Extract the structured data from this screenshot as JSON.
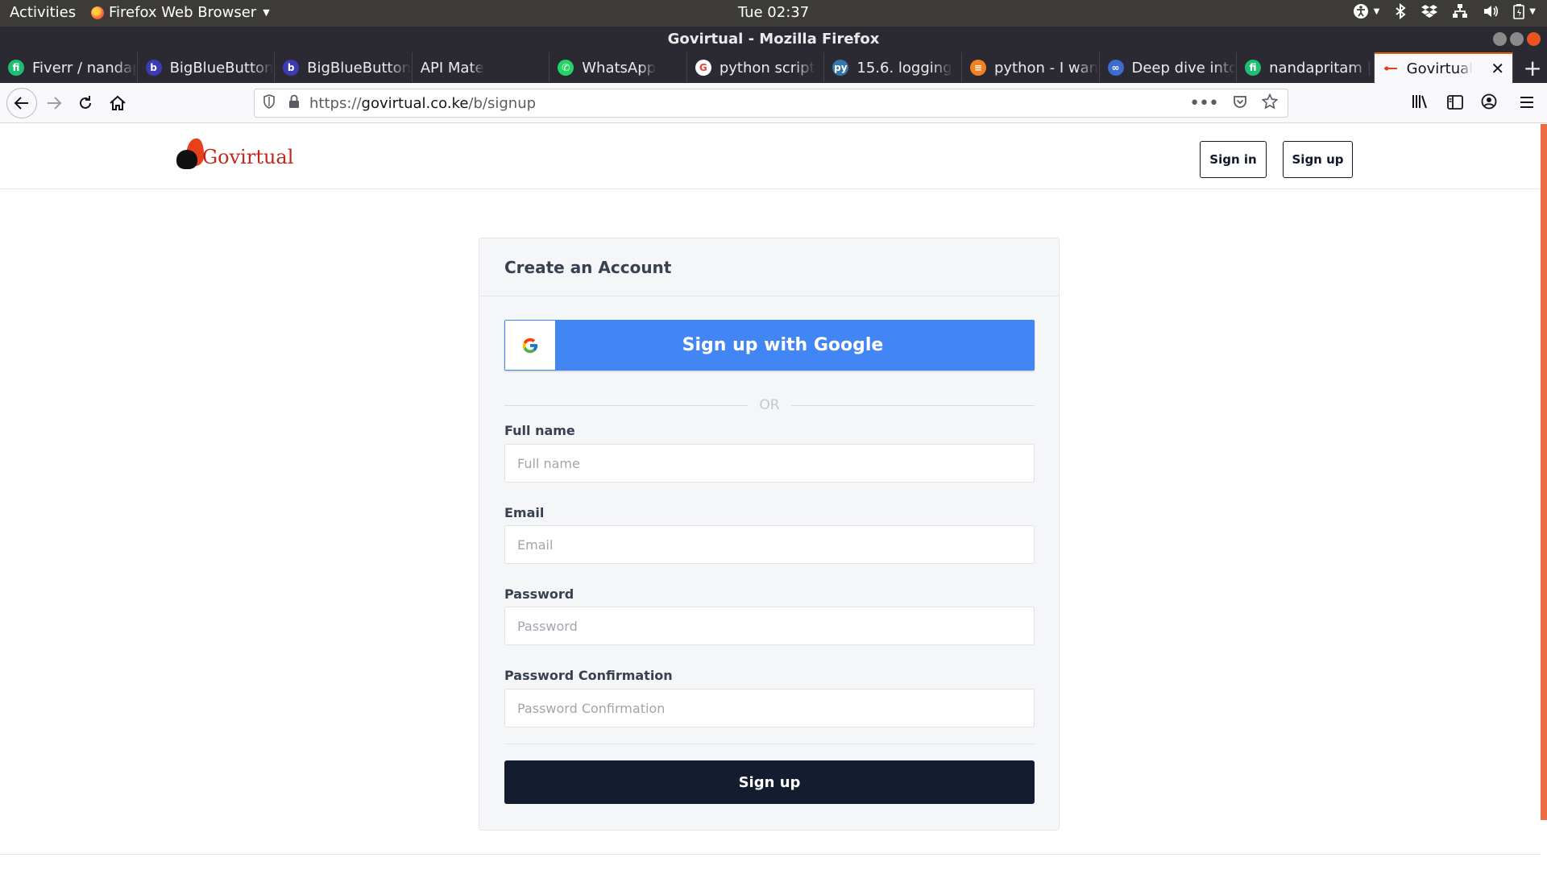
{
  "system_bar": {
    "activities": "Activities",
    "app_name": "Firefox Web Browser",
    "clock": "Tue 02:37"
  },
  "window": {
    "title": "Govirtual - Mozilla Firefox"
  },
  "tabs": [
    {
      "label": "Fiverr / nandap",
      "favicon_color": "#1dbf73",
      "favicon_glyph": "fi"
    },
    {
      "label": "BigBlueButton",
      "favicon_color": "#3b3bb5",
      "favicon_glyph": "b"
    },
    {
      "label": "BigBlueButton",
      "favicon_color": "#3b3bb5",
      "favicon_glyph": "b"
    },
    {
      "label": "API Mate",
      "favicon_color": "",
      "favicon_glyph": ""
    },
    {
      "label": "WhatsApp",
      "favicon_color": "#25d366",
      "favicon_glyph": "✆"
    },
    {
      "label": "python script",
      "favicon_color": "#ffffff",
      "favicon_glyph": "G"
    },
    {
      "label": "15.6. logging",
      "favicon_color": "#3776ab",
      "favicon_glyph": "py"
    },
    {
      "label": "python - I wan",
      "favicon_color": "#f48024",
      "favicon_glyph": "≡"
    },
    {
      "label": "Deep dive into",
      "favicon_color": "#3d6ccd",
      "favicon_glyph": "∞"
    },
    {
      "label": "nandapritam |",
      "favicon_color": "#1dbf73",
      "favicon_glyph": "fi"
    },
    {
      "label": "Govirtual",
      "favicon_color": "#e8401c",
      "favicon_glyph": "",
      "active": true
    }
  ],
  "navbar": {
    "url_prefix": "https://",
    "url_host": "govirtual.co.ke",
    "url_path": "/b/signup"
  },
  "site": {
    "logo_text": "Govirtual",
    "header_signin": "Sign in",
    "header_signup": "Sign up"
  },
  "signup": {
    "title": "Create an Account",
    "google_button": "Sign up with Google",
    "or_text": "OR",
    "fields": [
      {
        "label": "Full name",
        "placeholder": "Full name",
        "value": ""
      },
      {
        "label": "Email",
        "placeholder": "Email",
        "value": ""
      },
      {
        "label": "Password",
        "placeholder": "Password",
        "value": ""
      },
      {
        "label": "Password Confirmation",
        "placeholder": "Password Confirmation",
        "value": ""
      }
    ],
    "submit": "Sign up"
  },
  "colors": {
    "google_blue": "#4285f4",
    "submit_dark": "#141c2f",
    "brand_red": "#c0281b",
    "tab_accent": "#e66000"
  }
}
